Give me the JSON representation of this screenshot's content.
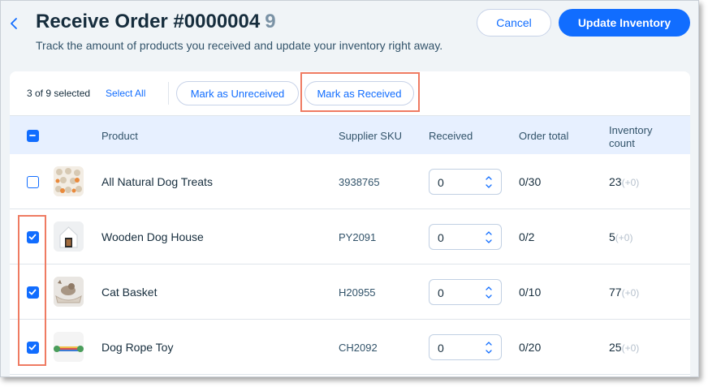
{
  "header": {
    "title": "Receive Order #0000004",
    "title_count": "9",
    "subtitle": "Track the amount of products you received and update your inventory right away.",
    "cancel_label": "Cancel",
    "update_label": "Update Inventory"
  },
  "toolbar": {
    "selected_text": "3 of 9 selected",
    "select_all_label": "Select All",
    "mark_unreceived_label": "Mark as Unreceived",
    "mark_received_label": "Mark as Received"
  },
  "table": {
    "columns": {
      "product": "Product",
      "sku": "Supplier SKU",
      "received": "Received",
      "order_total": "Order total",
      "inventory": "Inventory count"
    },
    "rows": [
      {
        "name": "All Natural Dog Treats",
        "sku": "3938765",
        "received": "0",
        "order_total": "0/30",
        "inventory": "23",
        "delta": "(+0)",
        "checked": false
      },
      {
        "name": "Wooden Dog House",
        "sku": "PY2091",
        "received": "0",
        "order_total": "0/2",
        "inventory": "5",
        "delta": "(+0)",
        "checked": true
      },
      {
        "name": "Cat Basket",
        "sku": "H20955",
        "received": "0",
        "order_total": "0/10",
        "inventory": "77",
        "delta": "(+0)",
        "checked": true
      },
      {
        "name": "Dog Rope Toy",
        "sku": "CH2092",
        "received": "0",
        "order_total": "0/20",
        "inventory": "25",
        "delta": "(+0)",
        "checked": true
      }
    ]
  },
  "colors": {
    "accent": "#116dff",
    "highlight": "#ef7b62",
    "header_bg": "#e7f0ff",
    "page_bg": "#f0f4f7"
  },
  "icons": {
    "back": "chevron-left-icon",
    "checkbox_header": "minus-checkbox-icon",
    "checkbox_checked": "check-icon",
    "stepper_up": "chevron-up-icon",
    "stepper_down": "chevron-down-icon"
  }
}
